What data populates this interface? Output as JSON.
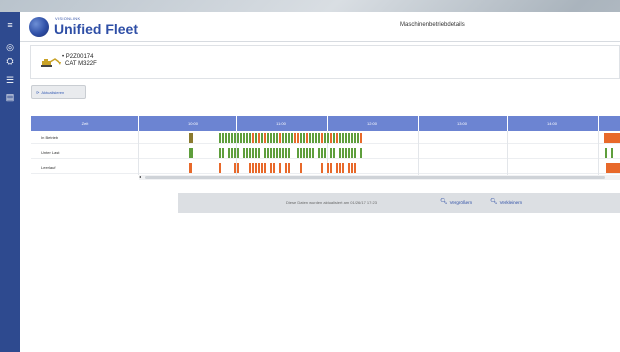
{
  "header": {
    "brand_small": "VISIONLINK",
    "brand": "Unified Fleet",
    "page_title": "Maschinenbetriebdetails"
  },
  "sidebar": {
    "items": [
      {
        "icon": "menu-icon",
        "glyph": "≡"
      },
      {
        "icon": "gauge-icon",
        "glyph": "◎"
      },
      {
        "icon": "machines-icon",
        "glyph": "⛭"
      },
      {
        "icon": "list-icon",
        "glyph": "☰"
      },
      {
        "icon": "report-icon",
        "glyph": "▤"
      }
    ]
  },
  "machine": {
    "id": "• P2Z00174",
    "model": "CAT   M322F"
  },
  "refresh_label": "Aktualisieren",
  "timeline": {
    "time_header": "Zeit",
    "hours": [
      "10:00",
      "11:00",
      "12:00",
      "13:00",
      "14:00"
    ],
    "rows": [
      {
        "label": "In Betrieb"
      },
      {
        "label": "Unter Last"
      },
      {
        "label": "Leerlauf"
      }
    ],
    "colors": {
      "green": "#5e9e3c",
      "orange": "#e8692a",
      "olive": "#8a7a2f",
      "header": "#6c84d2"
    }
  },
  "footer": {
    "text": "Diese Daten wurden aktualisiert am 01/26/17 17:23",
    "zoom_in": "Vergrößern",
    "zoom_out": "Verkleinern"
  }
}
